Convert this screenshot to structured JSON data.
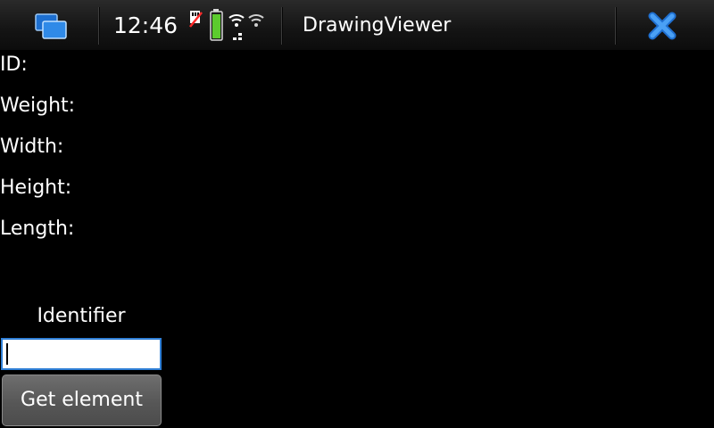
{
  "statusbar": {
    "time": "12:46",
    "app_title": "DrawingViewer",
    "icons": [
      "task-switcher-icon",
      "sim-icon",
      "battery-icon",
      "wifi-icon",
      "close-icon"
    ]
  },
  "fields": {
    "id_label": "ID:",
    "weight_label": "Weight:",
    "width_label": "Width:",
    "height_label": "Height:",
    "length_label": "Length:"
  },
  "identifier": {
    "caption": "Identifier",
    "value": ""
  },
  "actions": {
    "get_element_label": "Get element"
  },
  "colors": {
    "background": "#000000",
    "accent": "#2f7fd6",
    "battery": "#5ccb2e"
  }
}
